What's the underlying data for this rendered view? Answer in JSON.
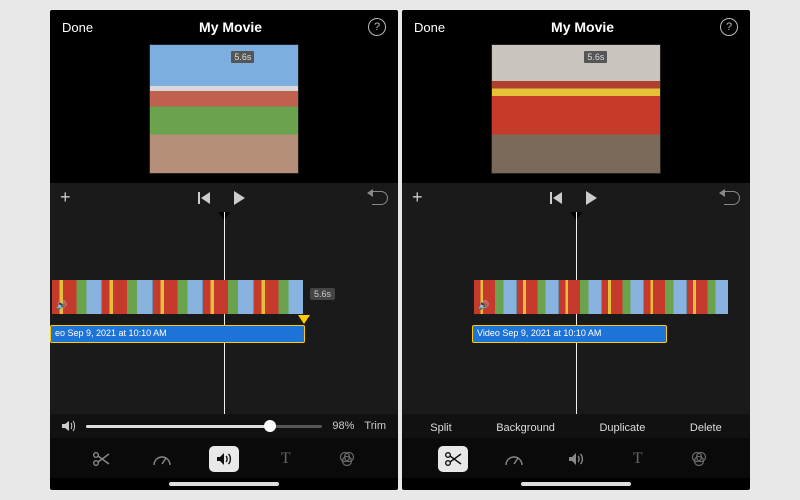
{
  "left": {
    "header": {
      "done": "Done",
      "title": "My Movie",
      "help": "?"
    },
    "preview": {
      "duration_badge": "5.6s"
    },
    "timeline": {
      "clip_duration_badge": "5.6s",
      "audio_clip_label": "eo Sep 9, 2021 at 10:10 AM"
    },
    "volume": {
      "percent_label": "98%",
      "trim_label": "Trim",
      "value_pct": 78
    },
    "tools": {
      "scissors": "scissors-icon",
      "speed": "speedometer-icon",
      "audio": "speaker-icon",
      "text": "T",
      "filters": "filters-icon",
      "active": "audio"
    }
  },
  "right": {
    "header": {
      "done": "Done",
      "title": "My Movie",
      "help": "?"
    },
    "preview": {
      "duration_badge": "5.6s"
    },
    "timeline": {
      "audio_clip_label": "Video Sep 9, 2021 at 10:10 AM"
    },
    "actions": {
      "split": "Split",
      "background": "Background",
      "duplicate": "Duplicate",
      "delete": "Delete"
    },
    "tools": {
      "scissors": "scissors-icon",
      "speed": "speedometer-icon",
      "audio": "speaker-icon",
      "text": "T",
      "filters": "filters-icon",
      "active": "scissors"
    }
  }
}
